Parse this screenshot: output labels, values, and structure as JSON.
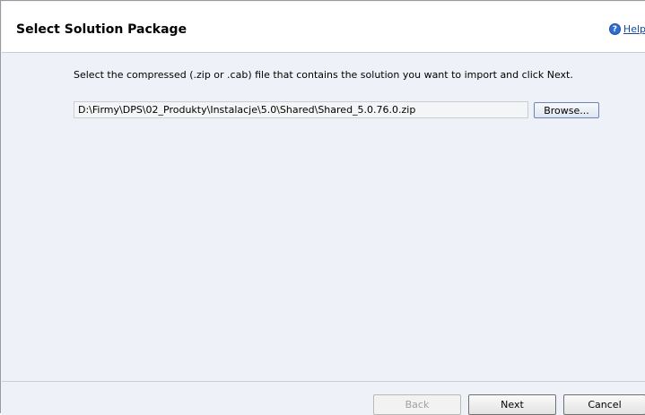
{
  "header": {
    "title": "Select Solution Package",
    "help_label": "Help"
  },
  "body": {
    "instruction": "Select the compressed (.zip or .cab) file that contains the solution you want to import and click Next.",
    "file_path": "D:\\Firmy\\DPS\\02_Produkty\\Instalacje\\5.0\\Shared\\Shared_5.0.76.0.zip",
    "browse_label": "Browse..."
  },
  "footer": {
    "back_label": "Back",
    "next_label": "Next",
    "cancel_label": "Cancel"
  },
  "icons": {
    "help": "help-icon"
  },
  "colors": {
    "body_background": "#eef1f7",
    "header_background": "#ffffff",
    "help_link": "#1a4aa0"
  }
}
